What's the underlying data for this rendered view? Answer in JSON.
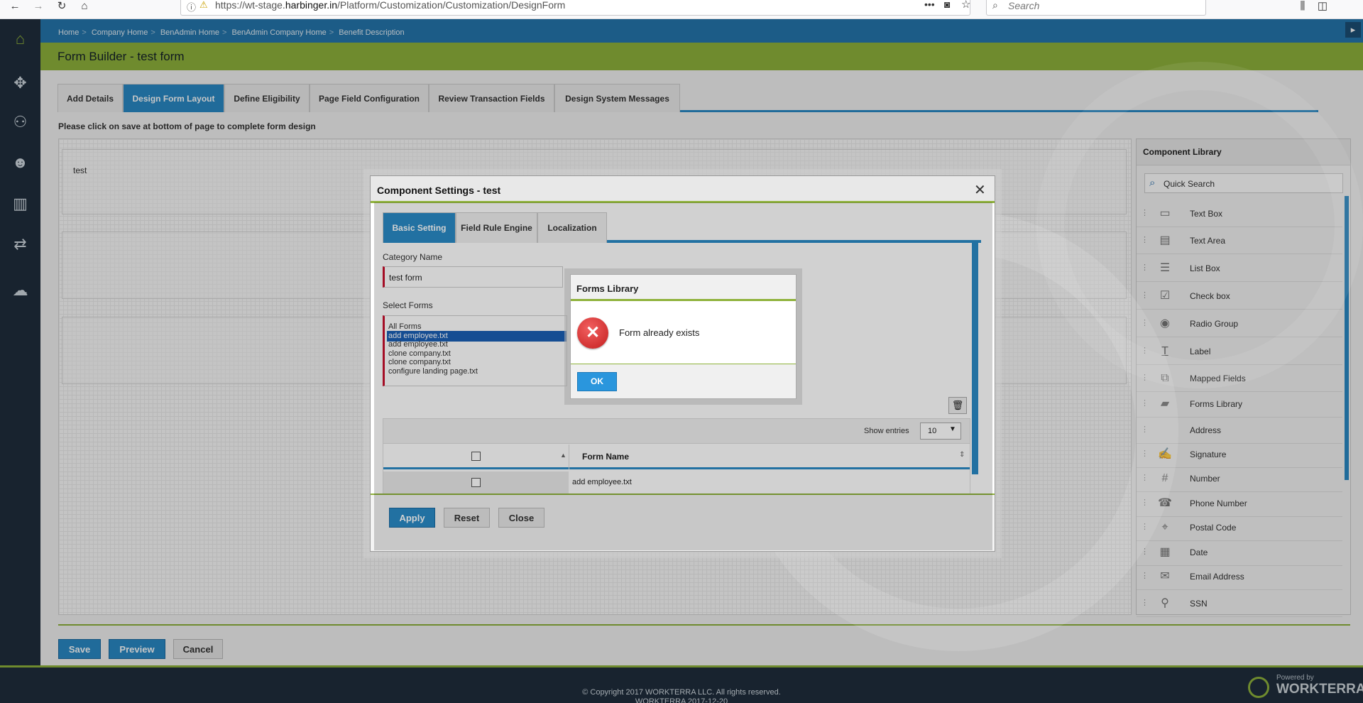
{
  "browser": {
    "url_prefix": "https://wt-stage.",
    "url_domain": "harbinger.in",
    "url_path": "/Platform/Customization/Customization/DesignForm",
    "search_placeholder": "Search",
    "icons": [
      "back-icon",
      "forward-icon",
      "reload-icon",
      "home-icon",
      "info-icon",
      "more-icon",
      "pocket-icon",
      "bookmark-star-icon",
      "library-icon",
      "sidebar-icon"
    ]
  },
  "breadcrumb": [
    "Home",
    "Company Home",
    "BenAdmin Home",
    "BenAdmin Company Home",
    "Benefit Description"
  ],
  "page_title": "Form Builder - test form",
  "tabs": [
    "Add Details",
    "Design Form Layout",
    "Define Eligibility",
    "Page Field Configuration",
    "Review Transaction Fields",
    "Design System Messages"
  ],
  "active_tab": "Design Form Layout",
  "instruction": "Please click on save at bottom of page to complete form design",
  "canvas": {
    "section_label": "test"
  },
  "component_library": {
    "title": "Component Library",
    "search_placeholder": "Quick Search",
    "items": [
      {
        "label": "Text Box",
        "icon": "textbox-icon"
      },
      {
        "label": "Text Area",
        "icon": "textarea-icon"
      },
      {
        "label": "List Box",
        "icon": "listbox-icon"
      },
      {
        "label": "Check box",
        "icon": "checkbox-icon"
      },
      {
        "label": "Radio Group",
        "icon": "radio-icon"
      },
      {
        "label": "Label",
        "icon": "label-icon"
      },
      {
        "label": "Mapped Fields",
        "icon": "mapped-fields-icon"
      },
      {
        "label": "Forms Library",
        "icon": "folder-icon"
      },
      {
        "label": "Address",
        "icon": ""
      },
      {
        "label": "Signature",
        "icon": "signature-icon"
      },
      {
        "label": "Number",
        "icon": "hash-icon"
      },
      {
        "label": "Phone Number",
        "icon": "phone-icon"
      },
      {
        "label": "Postal Code",
        "icon": "map-pin-icon"
      },
      {
        "label": "Date",
        "icon": "calendar-icon"
      },
      {
        "label": "Email Address",
        "icon": "envelope-icon"
      },
      {
        "label": "SSN",
        "icon": "person-icon"
      }
    ]
  },
  "actions": {
    "save": "Save",
    "preview": "Preview",
    "cancel": "Cancel"
  },
  "footer": {
    "copyright": "© Copyright 2017 WORKTERRA LLC. All rights reserved.",
    "version": "WORKTERRA 2017-12-20",
    "powered_by": "Powered by",
    "brand": "WORKTERRA"
  },
  "component_settings": {
    "title": "Component Settings - test",
    "tabs": [
      "Basic Setting",
      "Field Rule Engine",
      "Localization"
    ],
    "active_tab": "Basic Setting",
    "category_label": "Category Name",
    "category_value": "test form",
    "select_forms_label": "Select Forms",
    "form_options": [
      "All Forms",
      "add employee.txt",
      "add employee.txt",
      "clone company.txt",
      "clone company.txt",
      "configure landing page.txt"
    ],
    "selected_option_index": 1,
    "show_entries_label": "Show entries",
    "entries_value": "10",
    "column_header": "Form Name",
    "rows": [
      "add employee.txt"
    ],
    "buttons": {
      "apply": "Apply",
      "reset": "Reset",
      "close": "Close"
    }
  },
  "alert": {
    "title": "Forms Library",
    "message": "Form already exists",
    "ok": "OK"
  },
  "colors": {
    "primary_blue": "#2a8ac6",
    "accent_green": "#8fb23b",
    "nav_dark": "#1f2e3d",
    "error_red": "#d32f2f"
  }
}
